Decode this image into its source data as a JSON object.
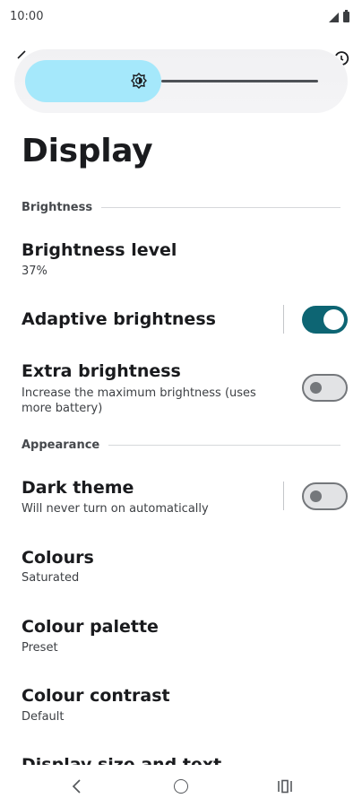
{
  "status_bar": {
    "time": "10:00",
    "icons": [
      "signal-icon",
      "battery-icon"
    ]
  },
  "brightness_slider": {
    "icon": "brightness-icon",
    "level_fraction": 0.37,
    "fill_color": "#a5e8fb"
  },
  "page": {
    "title": "Display"
  },
  "sections": {
    "brightness": {
      "header": "Brightness"
    },
    "appearance": {
      "header": "Appearance"
    }
  },
  "prefs": {
    "brightness_level": {
      "title": "Brightness level",
      "summary": "37%"
    },
    "adaptive_brightness": {
      "title": "Adaptive brightness",
      "checked": true
    },
    "extra_brightness": {
      "title": "Extra brightness",
      "summary": "Increase the maximum brightness (uses more battery)",
      "checked": false
    },
    "dark_theme": {
      "title": "Dark theme",
      "summary": "Will never turn on automatically",
      "checked": false
    },
    "colours": {
      "title": "Colours",
      "summary": "Saturated"
    },
    "colour_palette": {
      "title": "Colour palette",
      "summary": "Preset"
    },
    "colour_contrast": {
      "title": "Colour contrast",
      "summary": "Default"
    },
    "display_size": {
      "title": "Display size and text"
    }
  },
  "colors": {
    "accent": "#0d6573",
    "switch_off": "#74777b"
  },
  "nav": {
    "icons": [
      "back-icon",
      "home-icon",
      "recents-icon"
    ]
  }
}
